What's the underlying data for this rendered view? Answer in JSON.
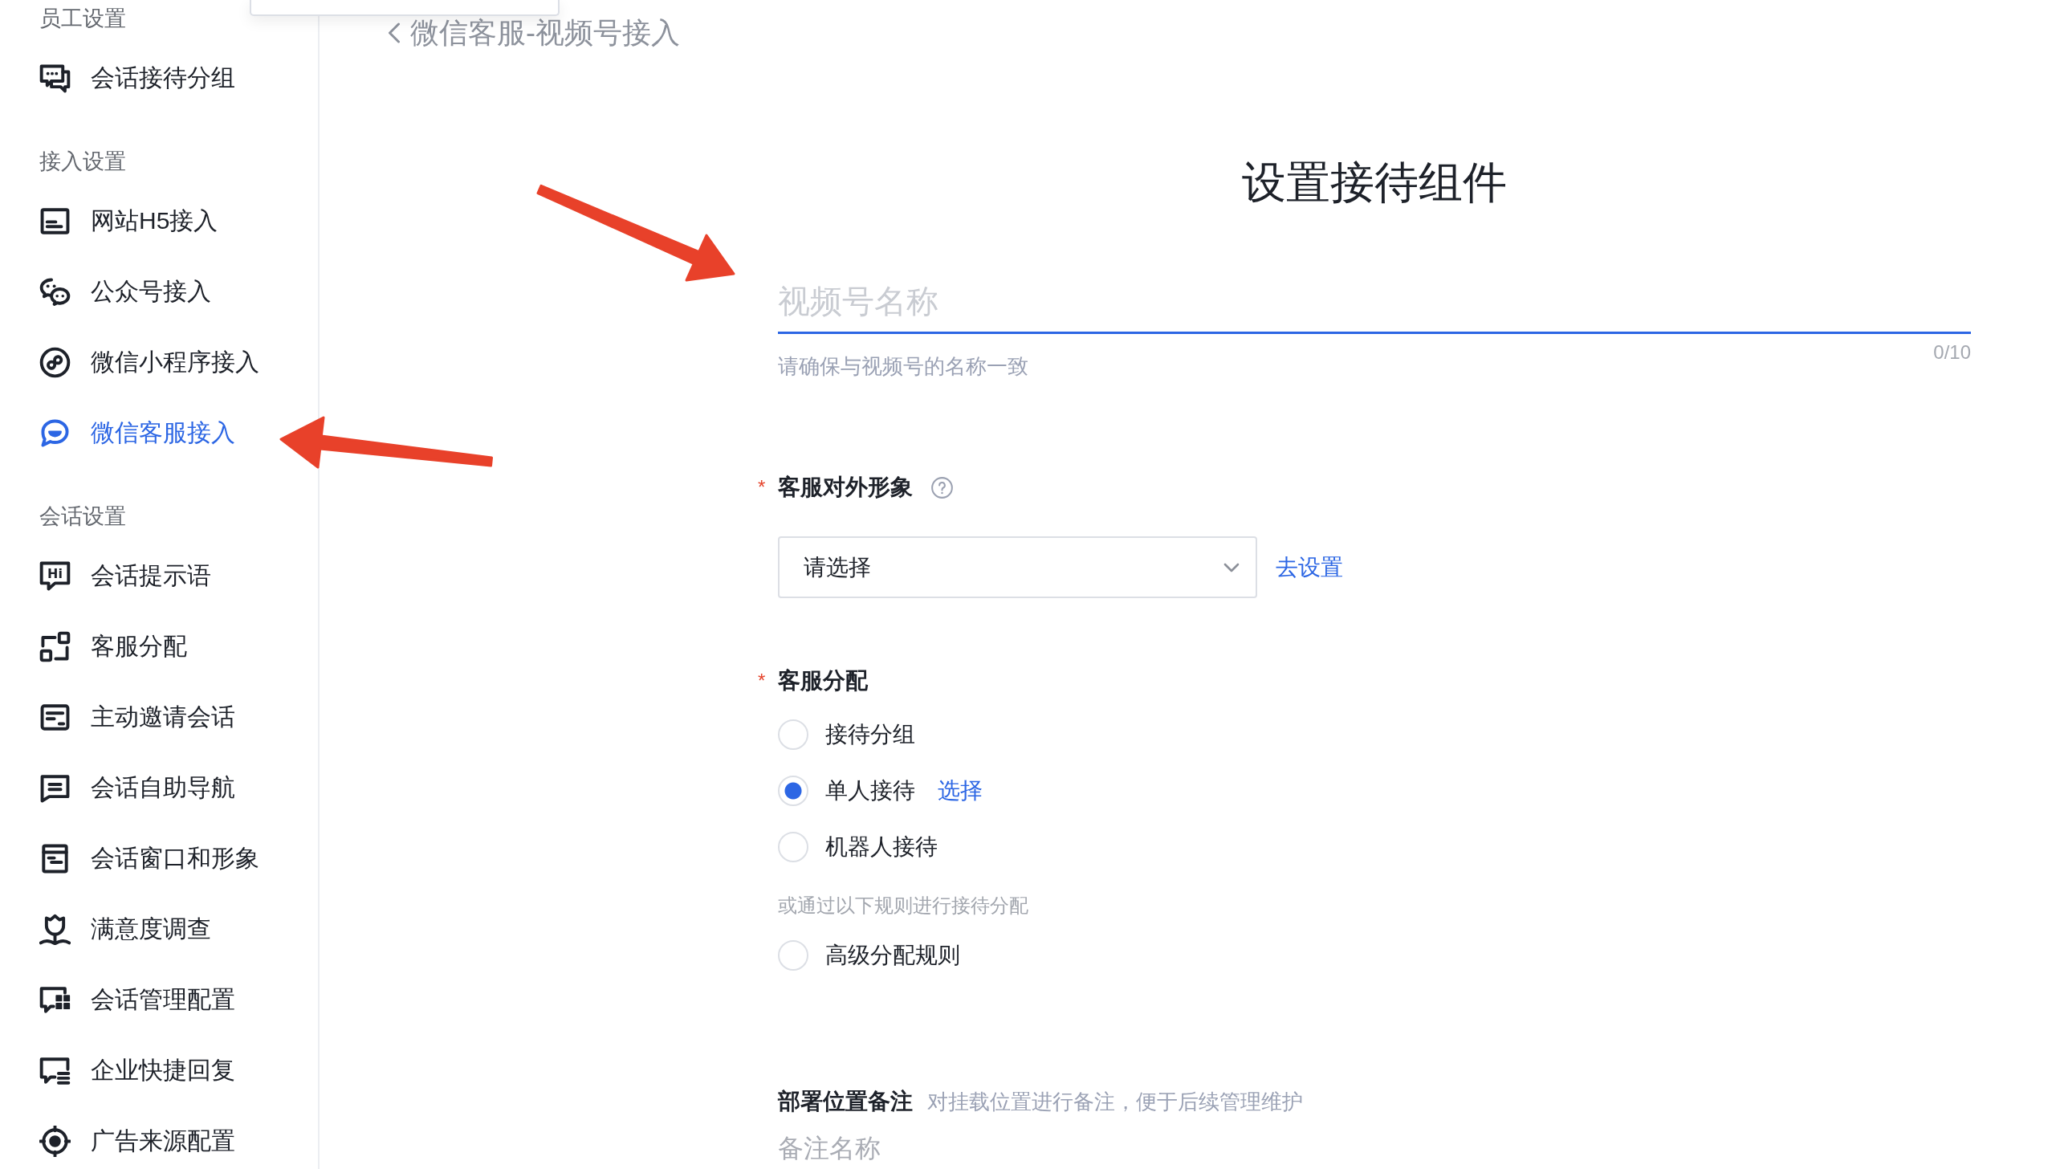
{
  "dropdown_panel": {
    "open": true
  },
  "sidebar": {
    "sections": [
      {
        "title": "员工设置",
        "items": [
          {
            "label": "会话接待分组",
            "selected": false
          }
        ]
      },
      {
        "title": "接入设置",
        "items": [
          {
            "label": "网站H5接入",
            "selected": false
          },
          {
            "label": "公众号接入",
            "selected": false
          },
          {
            "label": "微信小程序接入",
            "selected": false
          },
          {
            "label": "微信客服接入",
            "selected": true
          }
        ]
      },
      {
        "title": "会话设置",
        "items": [
          {
            "label": "会话提示语",
            "selected": false,
            "icon_text": "Hi"
          },
          {
            "label": "客服分配",
            "selected": false
          },
          {
            "label": "主动邀请会话",
            "selected": false
          },
          {
            "label": "会话自助导航",
            "selected": false
          },
          {
            "label": "会话窗口和形象",
            "selected": false
          },
          {
            "label": "满意度调查",
            "selected": false
          },
          {
            "label": "会话管理配置",
            "selected": false
          },
          {
            "label": "企业快捷回复",
            "selected": false
          },
          {
            "label": "广告来源配置",
            "selected": false
          }
        ]
      }
    ]
  },
  "back_link": {
    "label": "微信客服-视频号接入"
  },
  "form": {
    "title": "设置接待组件",
    "name_field": {
      "placeholder": "视频号名称",
      "focused": true,
      "hint": "请确保与视频号的名称一致",
      "counter": "0/10"
    },
    "appearance": {
      "required_mark": "*",
      "label": "客服对外形象",
      "select": {
        "placeholder": "请选择"
      },
      "link": "去设置"
    },
    "assignment": {
      "required_mark": "*",
      "label": "客服分配",
      "options": [
        {
          "label": "接待分组",
          "selected": false
        },
        {
          "label": "单人接待",
          "selected": true,
          "link": "选择"
        },
        {
          "label": "机器人接待",
          "selected": false
        }
      ],
      "note": "或通过以下规则进行接待分配",
      "advanced_options": [
        {
          "label": "高级分配规则",
          "selected": false
        }
      ]
    },
    "remark": {
      "label": "部署位置备注",
      "hint": "对挂载位置进行备注，便于后续管理维护",
      "placeholder": "备注名称"
    }
  },
  "annotations": [
    {
      "kind": "arrow"
    },
    {
      "kind": "arrow"
    }
  ]
}
